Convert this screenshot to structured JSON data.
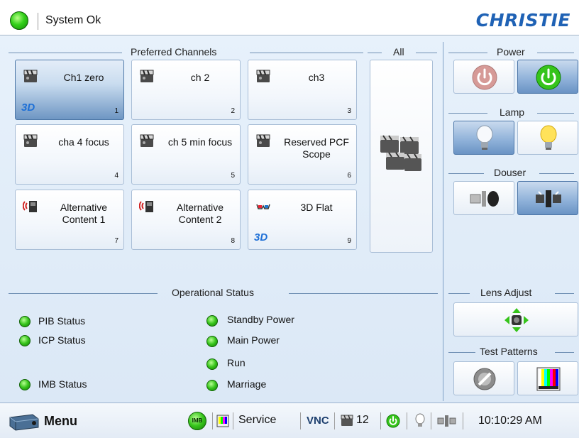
{
  "header": {
    "system_status": "System Ok",
    "logo_text": "CHRISTIE"
  },
  "sections": {
    "preferred_channels": "Preferred Channels",
    "all": "All",
    "power": "Power",
    "lamp": "Lamp",
    "douser": "Douser",
    "operational_status": "Operational Status",
    "lens_adjust": "Lens Adjust",
    "test_patterns": "Test Patterns"
  },
  "channels": [
    {
      "name": "Ch1 zero",
      "num": "1",
      "icon": "clapperboard-icon",
      "badge": "3D"
    },
    {
      "name": "ch 2",
      "num": "2",
      "icon": "clapperboard-icon",
      "badge": ""
    },
    {
      "name": "ch3",
      "num": "3",
      "icon": "clapperboard-icon",
      "badge": ""
    },
    {
      "name": "cha 4 focus",
      "num": "4",
      "icon": "clapperboard-icon",
      "badge": ""
    },
    {
      "name": "ch 5 min focus",
      "num": "5",
      "icon": "clapperboard-icon",
      "badge": ""
    },
    {
      "name": "Reserved PCF Scope",
      "num": "6",
      "icon": "clapperboard-icon",
      "badge": ""
    },
    {
      "name": "Alternative Content 1",
      "num": "7",
      "icon": "alternative-content-icon",
      "badge": ""
    },
    {
      "name": "Alternative Content 2",
      "num": "8",
      "icon": "alternative-content-icon",
      "badge": ""
    },
    {
      "name": "3D Flat",
      "num": "9",
      "icon": "3d-glasses-icon",
      "badge": "3D"
    }
  ],
  "status": {
    "left": [
      "PIB Status",
      "ICP Status",
      "IMB Status"
    ],
    "right": [
      "Standby Power",
      "Main Power",
      "Run",
      "Marriage"
    ]
  },
  "taskbar": {
    "menu_label": "Menu",
    "imb_label": "IMB",
    "service_label": "Service",
    "vnc_label": "VNC",
    "channel_count": "12",
    "clock": "10:10:29 AM"
  },
  "colors": {
    "accent": "#1f62b5",
    "status_ok": "#33d01a",
    "selected": "#6e96c3"
  }
}
